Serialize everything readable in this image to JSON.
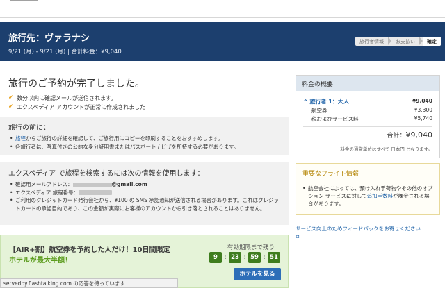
{
  "banner": {
    "destination": "旅行先：ヴァラナシ",
    "dates_total": "9/21 (月) - 9/21 (月) | 合計料金：¥9,040",
    "steps": [
      "旅行者情報",
      "お支払い",
      "確定"
    ]
  },
  "complete": {
    "title": "旅行のご予約が完了しました。",
    "checks": [
      "数分以内に確認メールが送信されます。",
      "エクスペディア アカウントが正常に作成されました"
    ]
  },
  "before_trip": {
    "title": "旅行の前に：",
    "item1_link": "旅程",
    "item1_rest": "からご旅行の詳細を確認して、ご旅行用にコピーを印刷することをおすすめします。",
    "item2": "各旅行者は、写真付きの公的な身分証明書またはパスポート / ビザを所持する必要があります。"
  },
  "search_info": {
    "title": "エクスペディア で旅程を検索するには次の情報を使用します：",
    "email_label": "確認用メールアドレス",
    "email_suffix": "@gmail.com",
    "itinerary_label": "エクスペディア 旅程番号：",
    "card_note": "ご利用のクレジットカード発行会社から、¥100 の SMS 承認通知が送信される場合があります。これはクレジットカードの承認目的であり、この金額が実際にお客様のアカウントから引き落とされることはありません。"
  },
  "promo": {
    "title": "【AIR+割】航空券を予約した人だけ！10日間限定",
    "subtitle": "ホテルが最大半額！",
    "deadline": "有効期限まで残り",
    "timer": [
      "9",
      "23",
      "59",
      "51"
    ],
    "button": "ホテルを見る"
  },
  "status_bar": "servedby.flashtalking.com の応答を待っています...",
  "summary": {
    "title": "料金の概要",
    "traveler": "旅行者 1：大人",
    "traveler_value": "¥9,040",
    "rows": [
      {
        "label": "航空券",
        "value": "¥3,300"
      },
      {
        "label": "税およびサービス料",
        "value": "¥5,740"
      }
    ],
    "total_label": "合計：",
    "total_value": "¥9,040",
    "note": "料金の通貨単位はすべて 日本円 となります。"
  },
  "flight_info": {
    "title": "重要なフライト情報",
    "text_before": "航空会社によっては、預け入れ手荷物やその他のオプション サービスに対して",
    "link": "追加手数料",
    "text_after": "が課金される場合があります。"
  },
  "feedback": "サービス向上のためフィードバックをお寄せください",
  "colors": {
    "banner": "#1c3f6e",
    "accent_link": "#1a5fa6",
    "promo_bg": "#e5f3d8",
    "timer_box": "#3f7d1e",
    "button": "#2d6eb8"
  }
}
